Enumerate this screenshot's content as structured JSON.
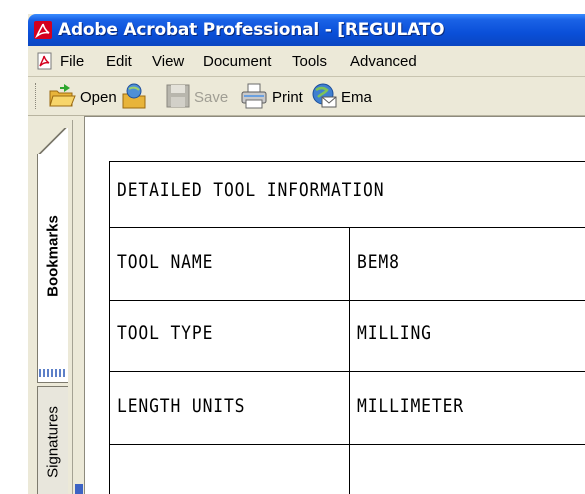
{
  "window": {
    "title": "Adobe Acrobat Professional - [REGULATO",
    "app_icon": "acrobat-icon"
  },
  "menubar": {
    "icon": "pdf-document-icon",
    "items": [
      "File",
      "Edit",
      "View",
      "Document",
      "Tools",
      "Advanced"
    ]
  },
  "toolbar": {
    "open_label": "Open",
    "save_label": "Save",
    "print_label": "Print",
    "email_label": "Ema",
    "icons": [
      "open-folder-icon",
      "organizer-icon",
      "save-disk-icon",
      "printer-icon",
      "email-icon"
    ]
  },
  "navpane": {
    "tabs": [
      {
        "label": "Bookmarks",
        "active": true
      },
      {
        "label": "Signatures",
        "active": false
      }
    ]
  },
  "document": {
    "heading": "DETAILED TOOL INFORMATION",
    "rows": [
      {
        "label": "TOOL NAME",
        "value": "BEM8"
      },
      {
        "label": "TOOL TYPE",
        "value": "MILLING"
      },
      {
        "label": "LENGTH UNITS",
        "value": "MILLIMETER"
      }
    ]
  },
  "colors": {
    "titlebar": "#0a4fd8",
    "chrome": "#ece9d8",
    "page": "#ffffff",
    "tab_separator": "#5d80c8"
  }
}
